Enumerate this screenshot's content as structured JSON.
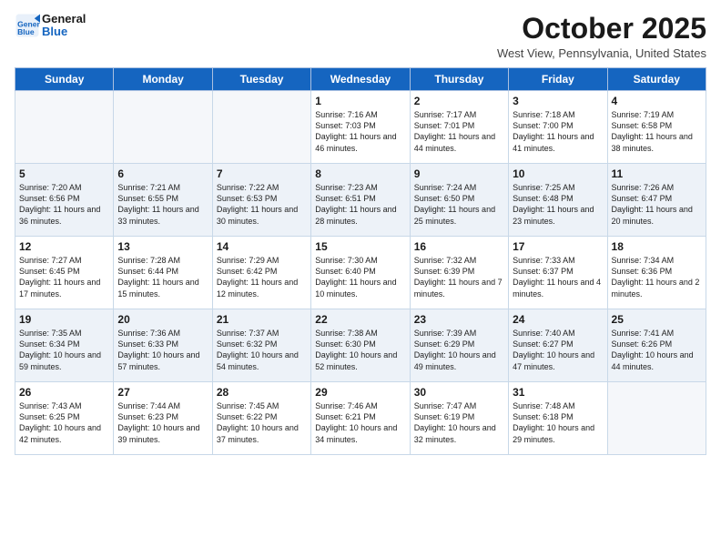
{
  "logo": {
    "line1": "General",
    "line2": "Blue"
  },
  "title": "October 2025",
  "subtitle": "West View, Pennsylvania, United States",
  "days_of_week": [
    "Sunday",
    "Monday",
    "Tuesday",
    "Wednesday",
    "Thursday",
    "Friday",
    "Saturday"
  ],
  "weeks": [
    [
      {
        "day": "",
        "sunrise": "",
        "sunset": "",
        "daylight": ""
      },
      {
        "day": "",
        "sunrise": "",
        "sunset": "",
        "daylight": ""
      },
      {
        "day": "",
        "sunrise": "",
        "sunset": "",
        "daylight": ""
      },
      {
        "day": "1",
        "sunrise": "Sunrise: 7:16 AM",
        "sunset": "Sunset: 7:03 PM",
        "daylight": "Daylight: 11 hours and 46 minutes."
      },
      {
        "day": "2",
        "sunrise": "Sunrise: 7:17 AM",
        "sunset": "Sunset: 7:01 PM",
        "daylight": "Daylight: 11 hours and 44 minutes."
      },
      {
        "day": "3",
        "sunrise": "Sunrise: 7:18 AM",
        "sunset": "Sunset: 7:00 PM",
        "daylight": "Daylight: 11 hours and 41 minutes."
      },
      {
        "day": "4",
        "sunrise": "Sunrise: 7:19 AM",
        "sunset": "Sunset: 6:58 PM",
        "daylight": "Daylight: 11 hours and 38 minutes."
      }
    ],
    [
      {
        "day": "5",
        "sunrise": "Sunrise: 7:20 AM",
        "sunset": "Sunset: 6:56 PM",
        "daylight": "Daylight: 11 hours and 36 minutes."
      },
      {
        "day": "6",
        "sunrise": "Sunrise: 7:21 AM",
        "sunset": "Sunset: 6:55 PM",
        "daylight": "Daylight: 11 hours and 33 minutes."
      },
      {
        "day": "7",
        "sunrise": "Sunrise: 7:22 AM",
        "sunset": "Sunset: 6:53 PM",
        "daylight": "Daylight: 11 hours and 30 minutes."
      },
      {
        "day": "8",
        "sunrise": "Sunrise: 7:23 AM",
        "sunset": "Sunset: 6:51 PM",
        "daylight": "Daylight: 11 hours and 28 minutes."
      },
      {
        "day": "9",
        "sunrise": "Sunrise: 7:24 AM",
        "sunset": "Sunset: 6:50 PM",
        "daylight": "Daylight: 11 hours and 25 minutes."
      },
      {
        "day": "10",
        "sunrise": "Sunrise: 7:25 AM",
        "sunset": "Sunset: 6:48 PM",
        "daylight": "Daylight: 11 hours and 23 minutes."
      },
      {
        "day": "11",
        "sunrise": "Sunrise: 7:26 AM",
        "sunset": "Sunset: 6:47 PM",
        "daylight": "Daylight: 11 hours and 20 minutes."
      }
    ],
    [
      {
        "day": "12",
        "sunrise": "Sunrise: 7:27 AM",
        "sunset": "Sunset: 6:45 PM",
        "daylight": "Daylight: 11 hours and 17 minutes."
      },
      {
        "day": "13",
        "sunrise": "Sunrise: 7:28 AM",
        "sunset": "Sunset: 6:44 PM",
        "daylight": "Daylight: 11 hours and 15 minutes."
      },
      {
        "day": "14",
        "sunrise": "Sunrise: 7:29 AM",
        "sunset": "Sunset: 6:42 PM",
        "daylight": "Daylight: 11 hours and 12 minutes."
      },
      {
        "day": "15",
        "sunrise": "Sunrise: 7:30 AM",
        "sunset": "Sunset: 6:40 PM",
        "daylight": "Daylight: 11 hours and 10 minutes."
      },
      {
        "day": "16",
        "sunrise": "Sunrise: 7:32 AM",
        "sunset": "Sunset: 6:39 PM",
        "daylight": "Daylight: 11 hours and 7 minutes."
      },
      {
        "day": "17",
        "sunrise": "Sunrise: 7:33 AM",
        "sunset": "Sunset: 6:37 PM",
        "daylight": "Daylight: 11 hours and 4 minutes."
      },
      {
        "day": "18",
        "sunrise": "Sunrise: 7:34 AM",
        "sunset": "Sunset: 6:36 PM",
        "daylight": "Daylight: 11 hours and 2 minutes."
      }
    ],
    [
      {
        "day": "19",
        "sunrise": "Sunrise: 7:35 AM",
        "sunset": "Sunset: 6:34 PM",
        "daylight": "Daylight: 10 hours and 59 minutes."
      },
      {
        "day": "20",
        "sunrise": "Sunrise: 7:36 AM",
        "sunset": "Sunset: 6:33 PM",
        "daylight": "Daylight: 10 hours and 57 minutes."
      },
      {
        "day": "21",
        "sunrise": "Sunrise: 7:37 AM",
        "sunset": "Sunset: 6:32 PM",
        "daylight": "Daylight: 10 hours and 54 minutes."
      },
      {
        "day": "22",
        "sunrise": "Sunrise: 7:38 AM",
        "sunset": "Sunset: 6:30 PM",
        "daylight": "Daylight: 10 hours and 52 minutes."
      },
      {
        "day": "23",
        "sunrise": "Sunrise: 7:39 AM",
        "sunset": "Sunset: 6:29 PM",
        "daylight": "Daylight: 10 hours and 49 minutes."
      },
      {
        "day": "24",
        "sunrise": "Sunrise: 7:40 AM",
        "sunset": "Sunset: 6:27 PM",
        "daylight": "Daylight: 10 hours and 47 minutes."
      },
      {
        "day": "25",
        "sunrise": "Sunrise: 7:41 AM",
        "sunset": "Sunset: 6:26 PM",
        "daylight": "Daylight: 10 hours and 44 minutes."
      }
    ],
    [
      {
        "day": "26",
        "sunrise": "Sunrise: 7:43 AM",
        "sunset": "Sunset: 6:25 PM",
        "daylight": "Daylight: 10 hours and 42 minutes."
      },
      {
        "day": "27",
        "sunrise": "Sunrise: 7:44 AM",
        "sunset": "Sunset: 6:23 PM",
        "daylight": "Daylight: 10 hours and 39 minutes."
      },
      {
        "day": "28",
        "sunrise": "Sunrise: 7:45 AM",
        "sunset": "Sunset: 6:22 PM",
        "daylight": "Daylight: 10 hours and 37 minutes."
      },
      {
        "day": "29",
        "sunrise": "Sunrise: 7:46 AM",
        "sunset": "Sunset: 6:21 PM",
        "daylight": "Daylight: 10 hours and 34 minutes."
      },
      {
        "day": "30",
        "sunrise": "Sunrise: 7:47 AM",
        "sunset": "Sunset: 6:19 PM",
        "daylight": "Daylight: 10 hours and 32 minutes."
      },
      {
        "day": "31",
        "sunrise": "Sunrise: 7:48 AM",
        "sunset": "Sunset: 6:18 PM",
        "daylight": "Daylight: 10 hours and 29 minutes."
      },
      {
        "day": "",
        "sunrise": "",
        "sunset": "",
        "daylight": ""
      }
    ]
  ]
}
